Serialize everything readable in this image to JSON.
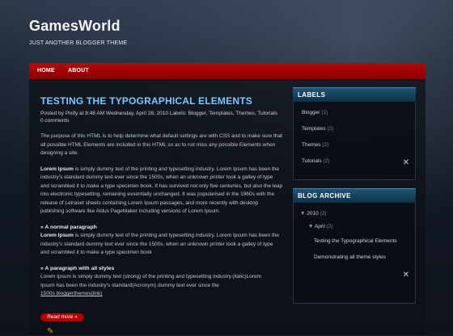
{
  "site": {
    "title": "GamesWorld",
    "description": "JUST ANOTHER BLOGGER THEME"
  },
  "nav": {
    "items": [
      {
        "label": "HOME"
      },
      {
        "label": "ABOUT"
      }
    ]
  },
  "post": {
    "title": "TESTING THE TYPOGRAPHICAL ELEMENTS",
    "meta_line1": "Posted by Pixify at 8:48 AM Wednesday, April 28, 2010 Labels: Blogger, Templates, Themes, Tutorials",
    "meta_line2": "0 comments",
    "intro": "The purpose of this HTML is to help determine what default settings are with CSS and to make sure that all possible HTML Elements are included in this HTML so as to not miss any possible Elements when designing a site.",
    "lorem_label": "Lorem Ipsum",
    "lorem_text": " is simply dummy text of the printing and typesetting industry. Lorem Ipsum has been the industry's standard dummy text ever since the 1500s, when an unknown printer took a galley of type and scrambled it to make a type specimen book. It has survived not only five centuries, but also the leap into electronic typesetting, remaining essentially unchanged. It was popularised in the 1960s with the release of Letraset sheets containing Lorem Ipsum passages, and more recently with desktop publishing software like Aldus PageMaker including versions of Lorem Ipsum.",
    "normal_heading": "» A normal paragraph",
    "normal_label": "Lorem Ipsum",
    "normal_text": " is simply dummy text of the printing and typesetting industry. Lorem Ipsum has been the industry's standard dummy text ever since the 1500s, when an unknown printer took a galley of type and scrambled it to make a type specimen book",
    "styles_heading": "» A paragraph with all styles",
    "styles_line1": "Lorem Ipsum is simply dummy text (strong) of the printing and typesetting industry.(italic)Lorem",
    "styles_line2": "Ipsum has been the industry's standard(Acronym) dummy text ever since the",
    "styles_line3": "1500s bloggerthemes(link)",
    "read_more": "Read more »"
  },
  "sidebar": {
    "labels_title": "LABELS",
    "labels": [
      {
        "name": "Blogger",
        "count": "(2)"
      },
      {
        "name": "Templates",
        "count": "(2)"
      },
      {
        "name": "Themes",
        "count": "(2)"
      },
      {
        "name": "Tutorials",
        "count": "(2)"
      }
    ],
    "archive_title": "BLOG ARCHIVE",
    "archive": {
      "year": "2010",
      "year_count": "(2)",
      "month": "April",
      "month_count": "(2)",
      "posts": [
        "Testing the Typographical Elements",
        "Demonstrating all theme styles"
      ]
    }
  },
  "colors": {
    "nav_red": "#a30000",
    "title_blue": "#7fc6ff",
    "widget_blue": "#1a4a68"
  },
  "icons": {
    "widget_tools": "tools-icon",
    "read_more_pencil": "pencil-icon"
  }
}
